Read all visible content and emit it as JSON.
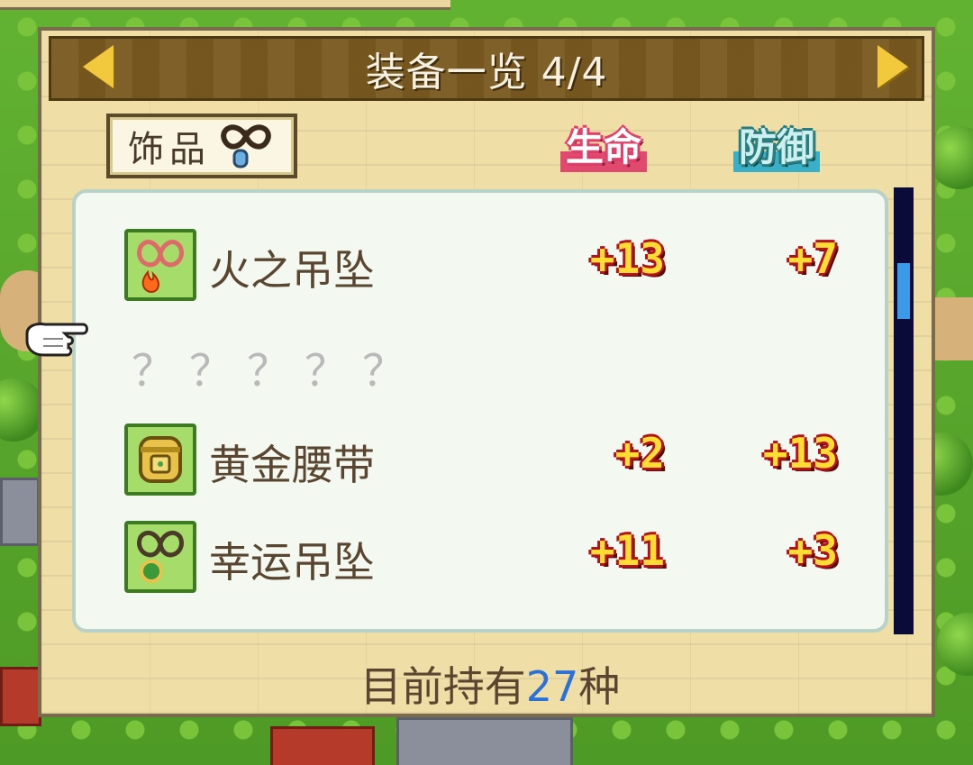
{
  "title": "装备一览 4/4",
  "category": {
    "label": "饰品",
    "icon": "pendant-icon"
  },
  "columns": {
    "life": "生命",
    "defense": "防御"
  },
  "items": [
    {
      "name": "火之吊坠",
      "icon": "fire-pendant-icon",
      "life": "+13",
      "defense": "+7"
    },
    {
      "name": "？？？？？",
      "unknown": true
    },
    {
      "name": "黄金腰带",
      "icon": "golden-belt-icon",
      "life": "+2",
      "defense": "+13"
    },
    {
      "name": "幸运吊坠",
      "icon": "lucky-pendant-icon",
      "life": "+11",
      "defense": "+3"
    }
  ],
  "footer": {
    "prefix": "目前持有",
    "count": "27",
    "suffix": "种"
  },
  "colors": {
    "life": "#e0406a",
    "defense": "#2a7d7d",
    "count": "#2a72d8",
    "panel": "#f0dea7",
    "title_bar": "#7b5a20"
  },
  "scroll_position": 0.15
}
